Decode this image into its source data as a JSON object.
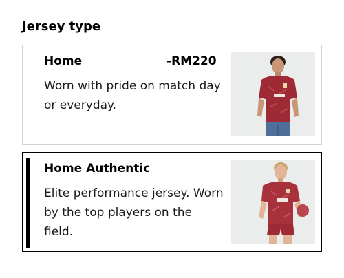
{
  "section": {
    "title": "Jersey type"
  },
  "options": [
    {
      "name": "Home",
      "price": "-RM220",
      "description": "Worn with pride on match day or everyday.",
      "image": "jersey-home-photo",
      "selected": false
    },
    {
      "name": "Home Authentic",
      "price": "",
      "description": "Elite performance jersey. Worn by the top players on the field.",
      "image": "jersey-authentic-photo",
      "selected": true
    }
  ],
  "colors": {
    "jersey_red": "#9e2a35",
    "card_border": "#d3d3d3",
    "selected_border": "#000000",
    "image_background": "#ebedec"
  }
}
